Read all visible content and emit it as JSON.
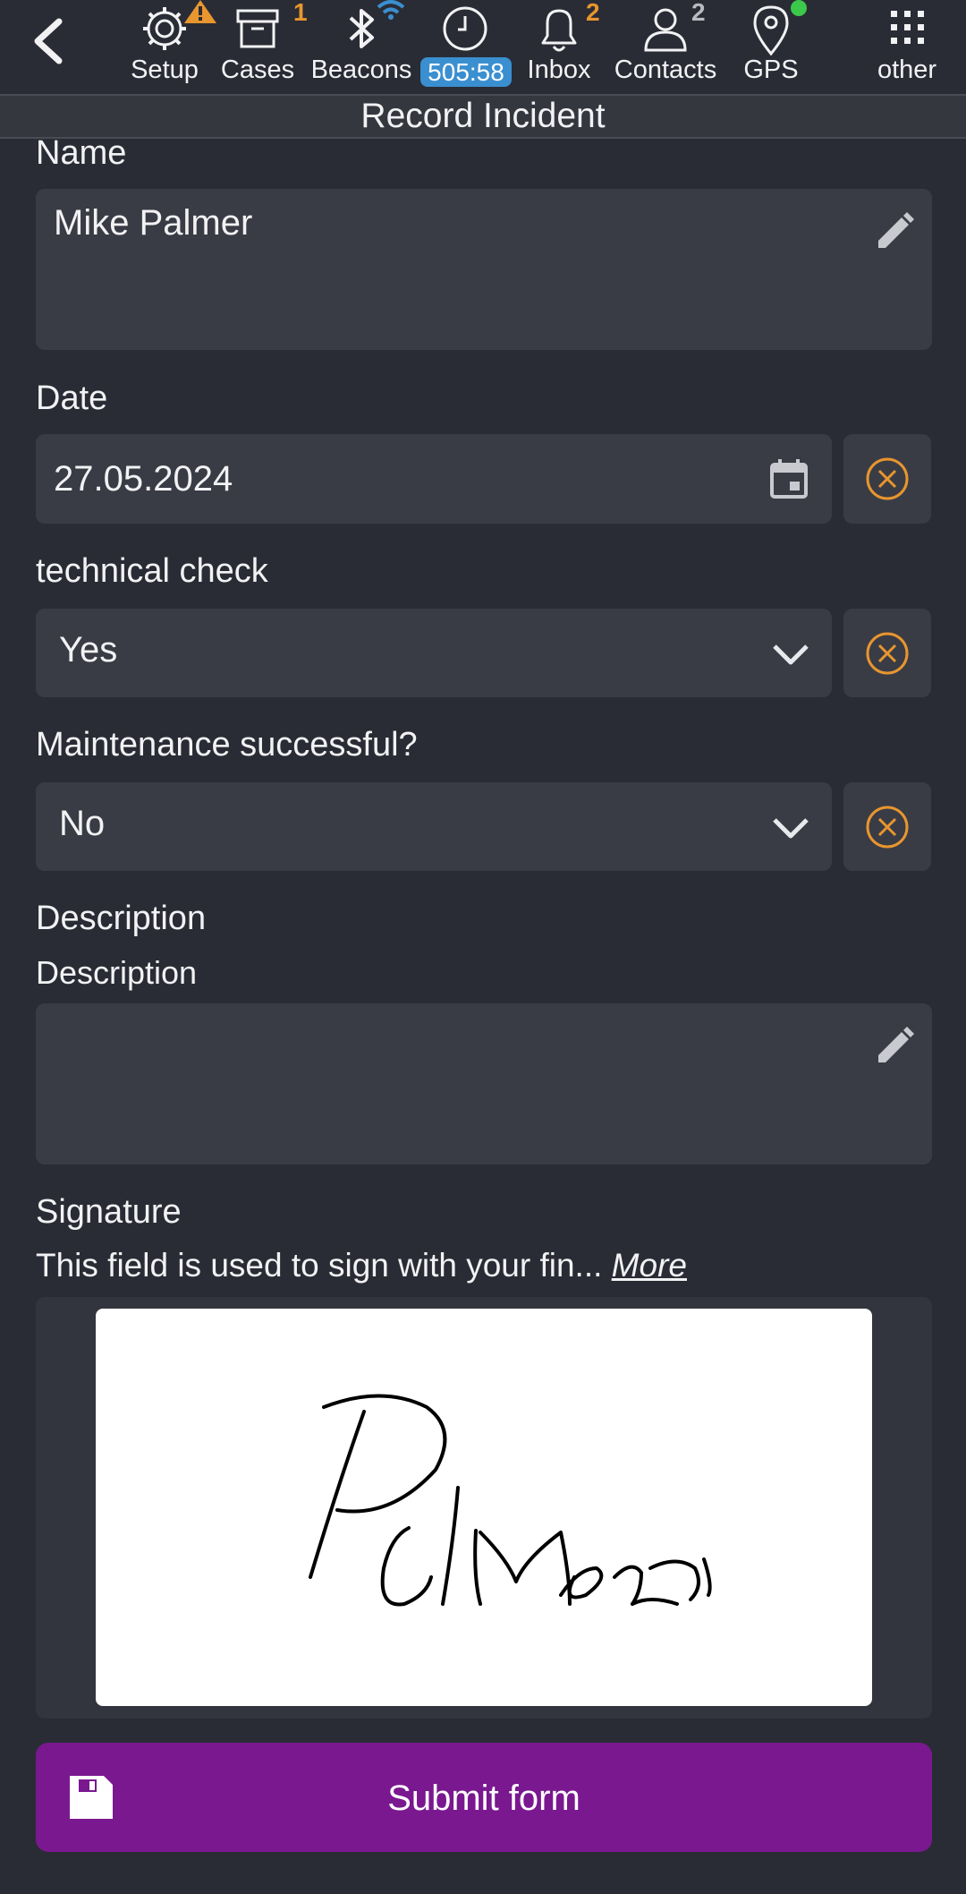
{
  "nav": {
    "setup_label": "Setup",
    "cases_label": "Cases",
    "cases_badge": "1",
    "beacons_label": "Beacons",
    "timer_value": "505:58",
    "inbox_label": "Inbox",
    "inbox_badge": "2",
    "contacts_label": "Contacts",
    "contacts_badge": "2",
    "gps_label": "GPS",
    "other_label": "other",
    "accent_color": "#e8962e",
    "timer_color": "#3a8fd0",
    "gps_status_color": "#3cc84a"
  },
  "page_title": "Record Incident",
  "form": {
    "name_label": "Name",
    "name_value": "Mike Palmer",
    "date_label": "Date",
    "date_value": "27.05.2024",
    "technical_check_label": "technical check",
    "technical_check_value": "Yes",
    "maintenance_label": "Maintenance successful?",
    "maintenance_value": "No",
    "description_heading": "Description",
    "description_label": "Description",
    "description_value": "",
    "signature_label": "Signature",
    "signature_hint": "This field is used to sign with your fin...",
    "signature_more": "More",
    "submit_label": "Submit form",
    "submit_color": "#7a1890"
  }
}
